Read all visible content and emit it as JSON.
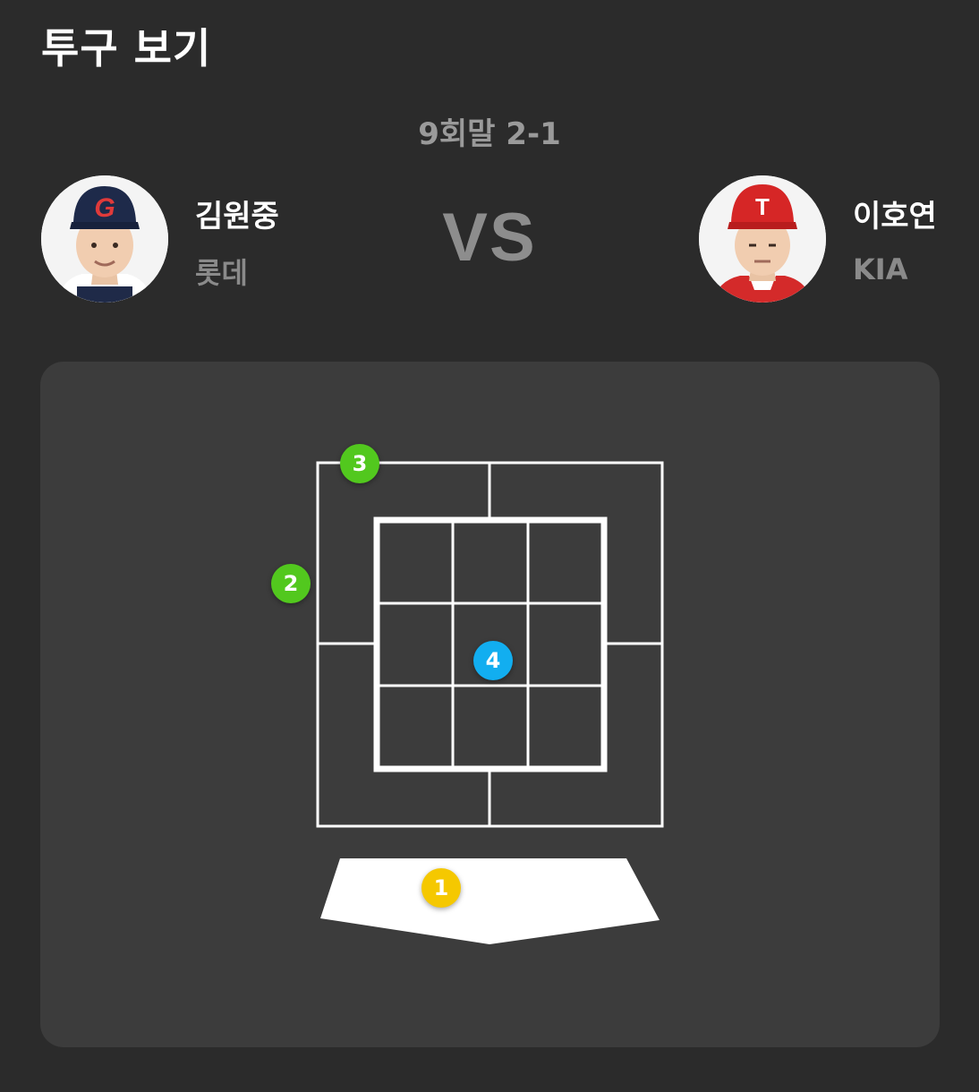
{
  "header": {
    "title": "투구 보기"
  },
  "game": {
    "inning": "9회말 2-1",
    "vs_label": "VS"
  },
  "pitcher": {
    "name": "김원중",
    "team": "롯데",
    "cap_letter": "G"
  },
  "batter": {
    "name": "이호연",
    "team": "KIA",
    "cap_letter": "T"
  },
  "pitches": [
    {
      "number": "1",
      "color": "#f5c800"
    },
    {
      "number": "2",
      "color": "#52c81e"
    },
    {
      "number": "3",
      "color": "#52c81e"
    },
    {
      "number": "4",
      "color": "#12aef0"
    }
  ]
}
